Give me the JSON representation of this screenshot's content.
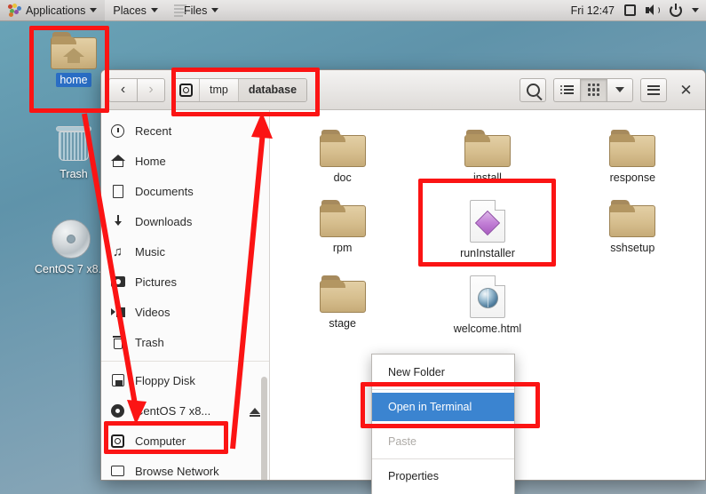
{
  "topbar": {
    "applications": "Applications",
    "places": "Places",
    "files": "Files",
    "clock": "Fri 12:47",
    "icons": [
      "gnome-launcher-icon",
      "screen-icon",
      "volume-icon",
      "power-icon",
      "chevron-down-icon"
    ]
  },
  "desktop": {
    "icons": [
      {
        "label": "home",
        "icon": "home-folder-icon",
        "selected": true
      },
      {
        "label": "Trash",
        "icon": "trash-icon",
        "selected": false
      },
      {
        "label": "CentOS 7 x8...",
        "icon": "cd-disc-icon",
        "selected": false
      }
    ]
  },
  "window": {
    "nav": {
      "back": "‹",
      "forward": "›"
    },
    "breadcrumb": [
      {
        "label": "",
        "icon": "computer-icon",
        "current": false
      },
      {
        "label": "tmp",
        "current": false
      },
      {
        "label": "database",
        "current": true
      }
    ],
    "toolbar": {
      "search": "search-icon",
      "list_view": "list-view-icon",
      "grid_view": "grid-view-icon",
      "view_options": "chevron-down-icon",
      "menu": "hamburger-menu-icon",
      "close": "close-icon"
    },
    "sidebar": {
      "items": [
        {
          "label": "Recent",
          "icon": "clock-icon"
        },
        {
          "label": "Home",
          "icon": "home-icon"
        },
        {
          "label": "Documents",
          "icon": "document-icon"
        },
        {
          "label": "Downloads",
          "icon": "download-icon"
        },
        {
          "label": "Music",
          "icon": "music-note-icon"
        },
        {
          "label": "Pictures",
          "icon": "camera-icon"
        },
        {
          "label": "Videos",
          "icon": "film-icon"
        },
        {
          "label": "Trash",
          "icon": "trash-icon"
        },
        {
          "label": "Floppy Disk",
          "icon": "floppy-icon"
        },
        {
          "label": "CentOS 7 x8...",
          "icon": "disc-icon",
          "eject": true
        },
        {
          "label": "Computer",
          "icon": "computer-icon",
          "highlighted": true
        },
        {
          "label": "Browse Network",
          "icon": "network-icon"
        }
      ]
    },
    "files": [
      {
        "name": "doc",
        "type": "folder"
      },
      {
        "name": "install",
        "type": "folder"
      },
      {
        "name": "response",
        "type": "folder"
      },
      {
        "name": "rpm",
        "type": "folder"
      },
      {
        "name": "runInstaller",
        "type": "script",
        "highlighted": true
      },
      {
        "name": "sshsetup",
        "type": "folder"
      },
      {
        "name": "stage",
        "type": "folder"
      },
      {
        "name": "welcome.html",
        "type": "html"
      }
    ]
  },
  "context_menu": {
    "items": [
      {
        "label": "New Folder",
        "mnemonic": "F",
        "state": "normal"
      },
      {
        "label": "Open in Terminal",
        "mnemonic": "T",
        "state": "selected"
      },
      {
        "label": "Paste",
        "mnemonic": "",
        "state": "disabled"
      },
      {
        "label": "Properties",
        "mnemonic": "r",
        "state": "normal"
      }
    ]
  },
  "annotations": {
    "color": "#fb1414",
    "boxes": [
      "home-desktop-icon",
      "breadcrumb-path",
      "runinstaller-file",
      "computer-sidebar-item",
      "open-in-terminal-menuitem"
    ],
    "arrows": [
      "home-to-computer-arrow",
      "computer-to-breadcrumb-arrow"
    ]
  }
}
